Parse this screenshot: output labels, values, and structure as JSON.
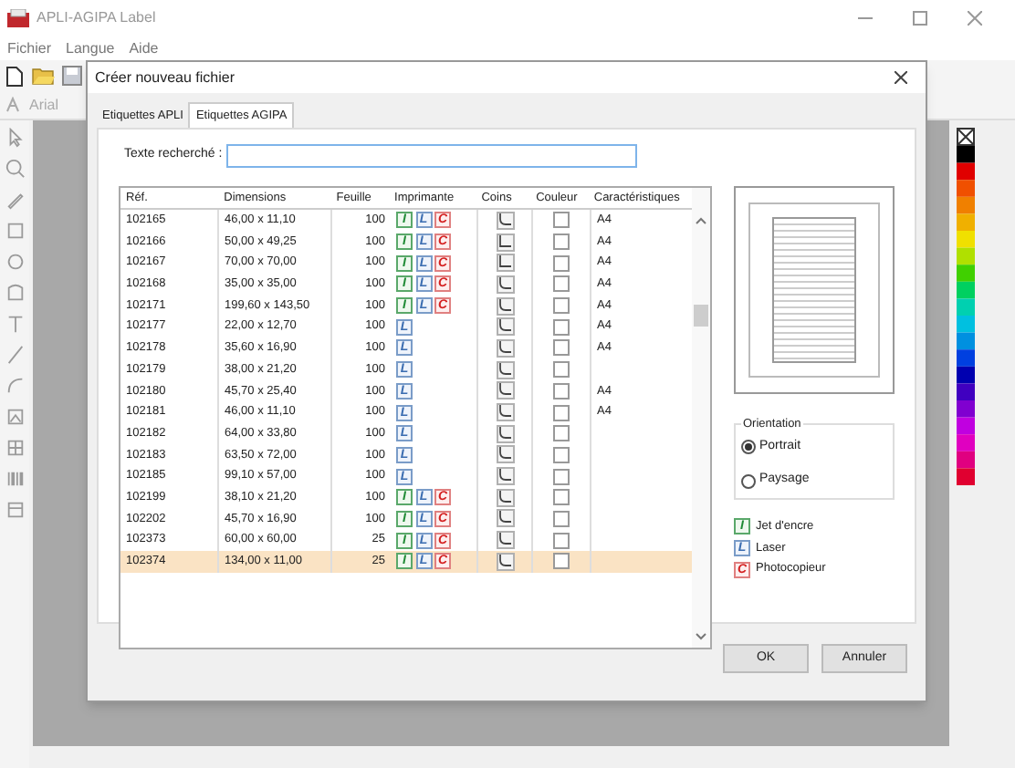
{
  "window": {
    "title": "APLI-AGIPA Label"
  },
  "menu": [
    "Fichier",
    "Langue",
    "Aide"
  ],
  "font_field": {
    "value": "Arial"
  },
  "dialog": {
    "title": "Créer nouveau fichier",
    "tabs": [
      {
        "label": "Etiquettes APLI",
        "selected": false
      },
      {
        "label": "Etiquettes AGIPA",
        "selected": true
      }
    ],
    "search": {
      "label": "Texte recherché :"
    },
    "table": {
      "columns": [
        "Réf.",
        "Dimensions",
        "Feuille",
        "Imprimante",
        "Coins",
        "Couleur",
        "Caractéristiques"
      ],
      "rows": [
        {
          "ref": "102165",
          "dimensions": "46,00 x 11,10",
          "sheets": "100",
          "printers": [
            {
              "kind": "inkjet",
              "letter": "I"
            },
            {
              "kind": "laser",
              "letter": "L"
            },
            {
              "kind": "copier",
              "letter": "C"
            }
          ],
          "corner": {
            "kind": "rounded"
          },
          "colour_checked": false,
          "features": "A4",
          "selected": false
        },
        {
          "ref": "102166",
          "dimensions": "50,00 x 49,25",
          "sheets": "100",
          "printers": [
            {
              "kind": "inkjet",
              "letter": "I"
            },
            {
              "kind": "laser",
              "letter": "L"
            },
            {
              "kind": "copier",
              "letter": "C"
            }
          ],
          "corner": {
            "kind": "square"
          },
          "colour_checked": false,
          "features": "A4",
          "selected": false
        },
        {
          "ref": "102167",
          "dimensions": "70,00 x 70,00",
          "sheets": "100",
          "printers": [
            {
              "kind": "inkjet",
              "letter": "I"
            },
            {
              "kind": "laser",
              "letter": "L"
            },
            {
              "kind": "copier",
              "letter": "C"
            }
          ],
          "corner": {
            "kind": "square"
          },
          "colour_checked": false,
          "features": "A4",
          "selected": false
        },
        {
          "ref": "102168",
          "dimensions": "35,00 x 35,00",
          "sheets": "100",
          "printers": [
            {
              "kind": "inkjet",
              "letter": "I"
            },
            {
              "kind": "laser",
              "letter": "L"
            },
            {
              "kind": "copier",
              "letter": "C"
            }
          ],
          "corner": {
            "kind": "rounded"
          },
          "colour_checked": false,
          "features": "A4",
          "selected": false
        },
        {
          "ref": "102171",
          "dimensions": "199,60 x 143,50",
          "sheets": "100",
          "printers": [
            {
              "kind": "inkjet",
              "letter": "I"
            },
            {
              "kind": "laser",
              "letter": "L"
            },
            {
              "kind": "copier",
              "letter": "C"
            }
          ],
          "corner": {
            "kind": "rounded"
          },
          "colour_checked": false,
          "features": "A4",
          "selected": false
        },
        {
          "ref": "102177",
          "dimensions": "22,00 x 12,70",
          "sheets": "100",
          "printers": [
            {
              "kind": "laser",
              "letter": "L"
            }
          ],
          "corner": {
            "kind": "rounded"
          },
          "colour_checked": false,
          "features": "A4",
          "selected": false
        },
        {
          "ref": "102178",
          "dimensions": "35,60 x 16,90",
          "sheets": "100",
          "printers": [
            {
              "kind": "laser",
              "letter": "L"
            }
          ],
          "corner": {
            "kind": "rounded"
          },
          "colour_checked": false,
          "features": "A4",
          "selected": false
        },
        {
          "ref": "102179",
          "dimensions": "38,00 x 21,20",
          "sheets": "100",
          "printers": [
            {
              "kind": "laser",
              "letter": "L"
            }
          ],
          "corner": {
            "kind": "rounded"
          },
          "colour_checked": false,
          "selected": false
        },
        {
          "ref": "102180",
          "dimensions": "45,70 x 25,40",
          "sheets": "100",
          "printers": [
            {
              "kind": "laser",
              "letter": "L"
            }
          ],
          "corner": {
            "kind": "rounded"
          },
          "colour_checked": false,
          "features": "A4",
          "selected": false
        },
        {
          "ref": "102181",
          "dimensions": "46,00 x 11,10",
          "sheets": "100",
          "printers": [
            {
              "kind": "laser",
              "letter": "L"
            }
          ],
          "corner": {
            "kind": "rounded"
          },
          "colour_checked": false,
          "features": "A4",
          "selected": false
        },
        {
          "ref": "102182",
          "dimensions": "64,00 x 33,80",
          "sheets": "100",
          "printers": [
            {
              "kind": "laser",
              "letter": "L"
            }
          ],
          "corner": {
            "kind": "rounded"
          },
          "colour_checked": false,
          "selected": false
        },
        {
          "ref": "102183",
          "dimensions": "63,50 x 72,00",
          "sheets": "100",
          "printers": [
            {
              "kind": "laser",
              "letter": "L"
            }
          ],
          "corner": {
            "kind": "rounded"
          },
          "colour_checked": false,
          "selected": false
        },
        {
          "ref": "102185",
          "dimensions": "99,10 x 57,00",
          "sheets": "100",
          "printers": [
            {
              "kind": "laser",
              "letter": "L"
            }
          ],
          "corner": {
            "kind": "rounded"
          },
          "colour_checked": false,
          "selected": false
        },
        {
          "ref": "102199",
          "dimensions": "38,10 x 21,20",
          "sheets": "100",
          "printers": [
            {
              "kind": "inkjet",
              "letter": "I"
            },
            {
              "kind": "laser",
              "letter": "L"
            },
            {
              "kind": "copier",
              "letter": "C"
            }
          ],
          "corner": {
            "kind": "rounded"
          },
          "colour_checked": false,
          "selected": false
        },
        {
          "ref": "102202",
          "dimensions": "45,70 x 16,90",
          "sheets": "100",
          "printers": [
            {
              "kind": "inkjet",
              "letter": "I"
            },
            {
              "kind": "laser",
              "letter": "L"
            },
            {
              "kind": "copier",
              "letter": "C"
            }
          ],
          "corner": {
            "kind": "rounded"
          },
          "colour_checked": false,
          "selected": false
        },
        {
          "ref": "102373",
          "dimensions": "60,00 x 60,00",
          "sheets": "25",
          "printers": [
            {
              "kind": "inkjet",
              "letter": "I"
            },
            {
              "kind": "laser",
              "letter": "L"
            },
            {
              "kind": "copier",
              "letter": "C"
            }
          ],
          "corner": {
            "kind": "rounded"
          },
          "colour_checked": false,
          "selected": false
        },
        {
          "ref": "102374",
          "dimensions": "134,00 x 11,00",
          "sheets": "25",
          "printers": [
            {
              "kind": "inkjet",
              "letter": "I"
            },
            {
              "kind": "laser",
              "letter": "L"
            },
            {
              "kind": "copier",
              "letter": "C"
            }
          ],
          "corner": {
            "kind": "rounded"
          },
          "colour_checked": false,
          "selected": true
        }
      ]
    },
    "orientation": {
      "legend": "Orientation",
      "options": [
        {
          "label": "Portrait",
          "selected": true
        },
        {
          "label": "Paysage",
          "selected": false
        }
      ]
    },
    "legend": [
      {
        "kind": "inkjet",
        "letter": "I",
        "label": "Jet d'encre"
      },
      {
        "kind": "laser",
        "letter": "L",
        "label": "Laser"
      },
      {
        "kind": "copier",
        "letter": "C",
        "label": "Photocopieur"
      }
    ],
    "buttons": [
      "OK",
      "Annuler"
    ]
  }
}
